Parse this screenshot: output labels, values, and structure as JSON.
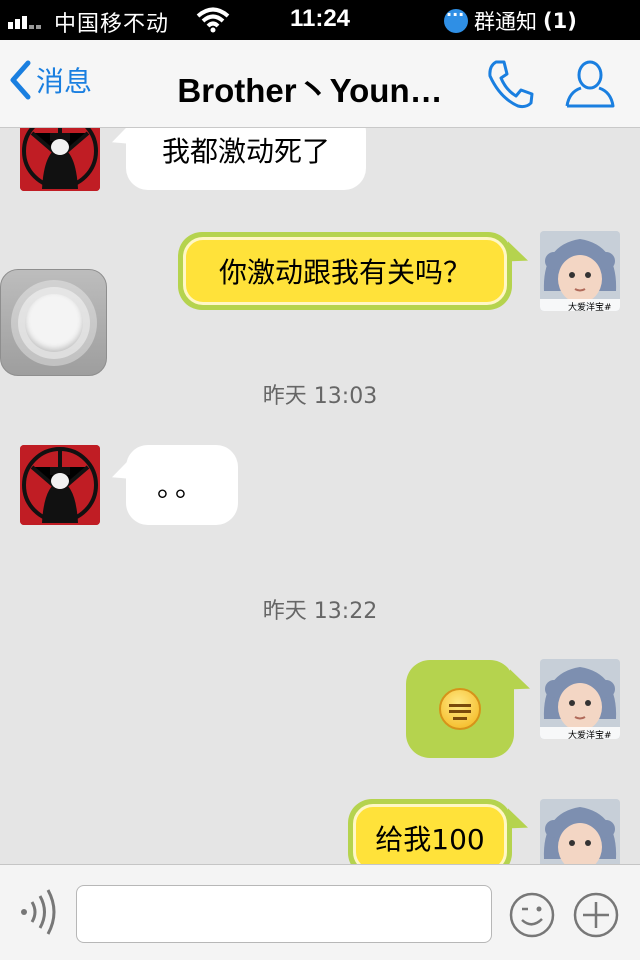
{
  "status_bar": {
    "carrier": "中国移不动",
    "time": "11:24",
    "notification_label": "群通知",
    "notification_count": "(1)"
  },
  "nav": {
    "back_label": "消息",
    "title": "Brother丶Youn…",
    "accent_color": "#1a7fe0"
  },
  "messages": [
    {
      "side": "in",
      "text": "我都激动死了"
    },
    {
      "side": "out",
      "text": "你激动跟我有关吗？"
    },
    {
      "side": "in",
      "text": "。。"
    },
    {
      "side": "out",
      "emoji": "speechless-face"
    },
    {
      "side": "out",
      "text": "给我100"
    }
  ],
  "timestamps": [
    "昨天 13:03",
    "昨天 13:22"
  ],
  "avatar_captions": {
    "self": "大爱洋宝#"
  },
  "input": {
    "value": "",
    "placeholder": ""
  },
  "colors": {
    "background": "#e5e5e5",
    "incoming_bubble": "#ffffff",
    "outgoing_bubble_border": "#b5d34e",
    "outgoing_bubble_fill": "#ffe23a"
  }
}
